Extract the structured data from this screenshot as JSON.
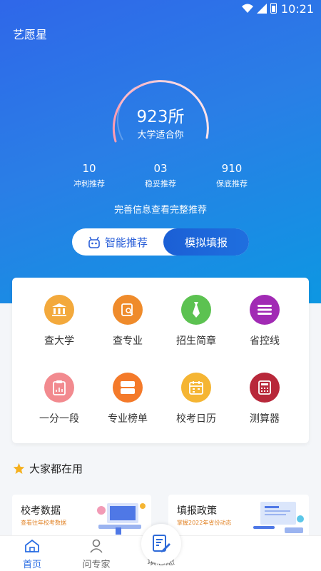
{
  "status_bar": {
    "time": "10:21"
  },
  "app": {
    "title": "艺愿星"
  },
  "gauge": {
    "count": "923所",
    "subtitle": "大学适合你"
  },
  "stats": [
    {
      "value": "10",
      "label": "冲刺推荐"
    },
    {
      "value": "03",
      "label": "稳妥推荐"
    },
    {
      "value": "910",
      "label": "保底推荐"
    }
  ],
  "complete_info": "完善信息查看完整推荐",
  "toggle": {
    "left_label": "智能推荐",
    "right_label": "模拟填报"
  },
  "grid": [
    {
      "label": "查大学",
      "icon": "university-icon",
      "color": "#f3a93c"
    },
    {
      "label": "查专业",
      "icon": "search-major-icon",
      "color": "#ef8b2b"
    },
    {
      "label": "招生简章",
      "icon": "tie-icon",
      "color": "#5cc251"
    },
    {
      "label": "省控线",
      "icon": "lines-icon",
      "color": "#a12ab4"
    },
    {
      "label": "一分一段",
      "icon": "clipboard-icon",
      "color": "#f28a8f"
    },
    {
      "label": "专业榜单",
      "icon": "ranking-icon",
      "color": "#f47a2a"
    },
    {
      "label": "校考日历",
      "icon": "calendar-icon",
      "color": "#f5b533"
    },
    {
      "label": "测算器",
      "icon": "calculator-icon",
      "color": "#b8283a"
    }
  ],
  "section": {
    "title": "大家都在用"
  },
  "features": [
    {
      "title": "校考数据",
      "subtitle": "查看往年校考数据"
    },
    {
      "title": "填报政策",
      "subtitle": "掌握2022年省份动态"
    }
  ],
  "tabs": [
    {
      "label": "首页"
    },
    {
      "label": "问专家"
    },
    {
      "label": "填志愿"
    }
  ],
  "colors": {
    "primary": "#2a6de3",
    "hero_start": "#2f67e9",
    "hero_end": "#0d97e2"
  }
}
